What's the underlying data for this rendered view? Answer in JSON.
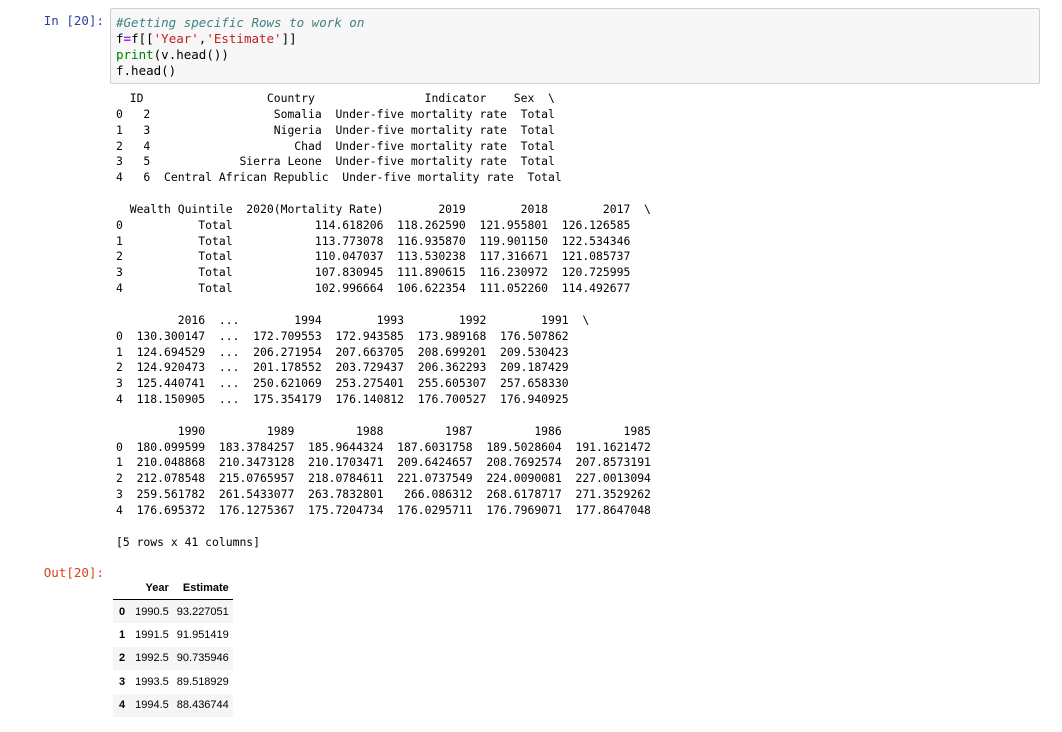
{
  "input_prompt": "In [20]:",
  "output_prompt": "Out[20]:",
  "code": {
    "comment": "#Getting specific Rows to work on",
    "line2": {
      "var": "f",
      "op": "=",
      "expr_a": "f[[",
      "str1": "'Year'",
      "sep": ",",
      "str2": "'Estimate'",
      "expr_b": "]]"
    },
    "line3": {
      "builtin": "print",
      "rest": "(v.head())"
    },
    "line4": "f.head()"
  },
  "stdout_lines": [
    "  ID                  Country                Indicator    Sex  \\",
    "0   2                  Somalia  Under-five mortality rate  Total",
    "1   3                  Nigeria  Under-five mortality rate  Total",
    "2   4                     Chad  Under-five mortality rate  Total",
    "3   5             Sierra Leone  Under-five mortality rate  Total",
    "4   6  Central African Republic  Under-five mortality rate  Total",
    "",
    "  Wealth Quintile  2020(Mortality Rate)        2019        2018        2017  \\",
    "0           Total            114.618206  118.262590  121.955801  126.126585",
    "1           Total            113.773078  116.935870  119.901150  122.534346",
    "2           Total            110.047037  113.530238  117.316671  121.085737",
    "3           Total            107.830945  111.890615  116.230972  120.725995",
    "4           Total            102.996664  106.622354  111.052260  114.492677",
    "",
    "         2016  ...        1994        1993        1992        1991  \\",
    "0  130.300147  ...  172.709553  172.943585  173.989168  176.507862",
    "1  124.694529  ...  206.271954  207.663705  208.699201  209.530423",
    "2  124.920473  ...  201.178552  203.729437  206.362293  209.187429",
    "3  125.440741  ...  250.621069  253.275401  255.605307  257.658330",
    "4  118.150905  ...  175.354179  176.140812  176.700527  176.940925",
    "",
    "         1990         1989         1988         1987         1986         1985",
    "0  180.099599  183.3784257  185.9644324  187.6031758  189.5028604  191.1621472",
    "1  210.048868  210.3473128  210.1703471  209.6424657  208.7692574  207.8573191",
    "2  212.078548  215.0765957  218.0784611  221.0737549  224.0090081  227.0013094",
    "3  259.561782  261.5433077  263.7832801   266.086312  268.6178717  271.3529262",
    "4  176.695372  176.1275367  175.7204734  176.0295711  176.7969071  177.8647048",
    "",
    "[5 rows x 41 columns]"
  ],
  "output_table": {
    "columns": [
      "",
      "Year",
      "Estimate"
    ],
    "rows": [
      {
        "index": "0",
        "year": "1990.5",
        "estimate": "93.227051"
      },
      {
        "index": "1",
        "year": "1991.5",
        "estimate": "91.951419"
      },
      {
        "index": "2",
        "year": "1992.5",
        "estimate": "90.735946"
      },
      {
        "index": "3",
        "year": "1993.5",
        "estimate": "89.518929"
      },
      {
        "index": "4",
        "year": "1994.5",
        "estimate": "88.436744"
      }
    ]
  },
  "colors": {
    "input_prompt": "#303f9f",
    "output_prompt": "#d84315",
    "input_bg": "#f7f7f7",
    "input_border": "#cfcfcf"
  }
}
